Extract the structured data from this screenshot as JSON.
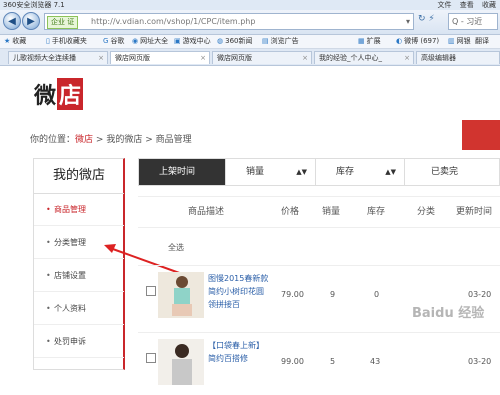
{
  "browser": {
    "title": "360安全浏览器 7.1",
    "menu": [
      "文件",
      "查看",
      "收藏"
    ],
    "security_label": "企业 证",
    "url": "http://v.vdian.com/vshop/1/CPC/item.php",
    "search_placeholder": "Q - 习近",
    "favorites": [
      "收藏",
      "手机收藏夹",
      "谷歌",
      "网址大全",
      "游戏中心",
      "360新闻",
      "浏览广告",
      "扩展",
      "微博 (697)",
      "网银",
      "翻译"
    ],
    "tabs": [
      "儿歌视频大全连续播",
      "微店网页版",
      "微店网页版",
      "我的经验_个人中心_",
      "高级编辑器"
    ]
  },
  "page": {
    "logo_text": "微",
    "logo_highlight": "店",
    "breadcrumb": {
      "prefix": "你的位置：",
      "link": "微店",
      "sep1": ">",
      "item2": "我的微店",
      "sep2": ">",
      "item3": "商品管理"
    }
  },
  "sidebar": {
    "title": "我的微店",
    "items": [
      "商品管理",
      "分类管理",
      "店铺设置",
      "个人资料",
      "处罚申诉"
    ]
  },
  "sortbar": {
    "items": [
      "上架时间",
      "销量",
      "库存",
      "已卖完"
    ]
  },
  "table": {
    "headers": [
      "商品描述",
      "价格",
      "销量",
      "库存",
      "分类",
      "更新时间"
    ],
    "select_all": "全选",
    "rows": [
      {
        "title": "图慢2015春新款简约小树印花圆领拼接百",
        "price": "79.00",
        "sales": "9",
        "stock": "0",
        "date": "03-20"
      },
      {
        "title": "【口袋春上新】简约百搭修",
        "price": "99.00",
        "sales": "5",
        "stock": "43",
        "date": "03-20"
      }
    ]
  },
  "watermark": "Baidu 经验",
  "colors": {
    "accent": "#c9262b",
    "active_sort": "#333333",
    "link": "#2b5fa8"
  }
}
